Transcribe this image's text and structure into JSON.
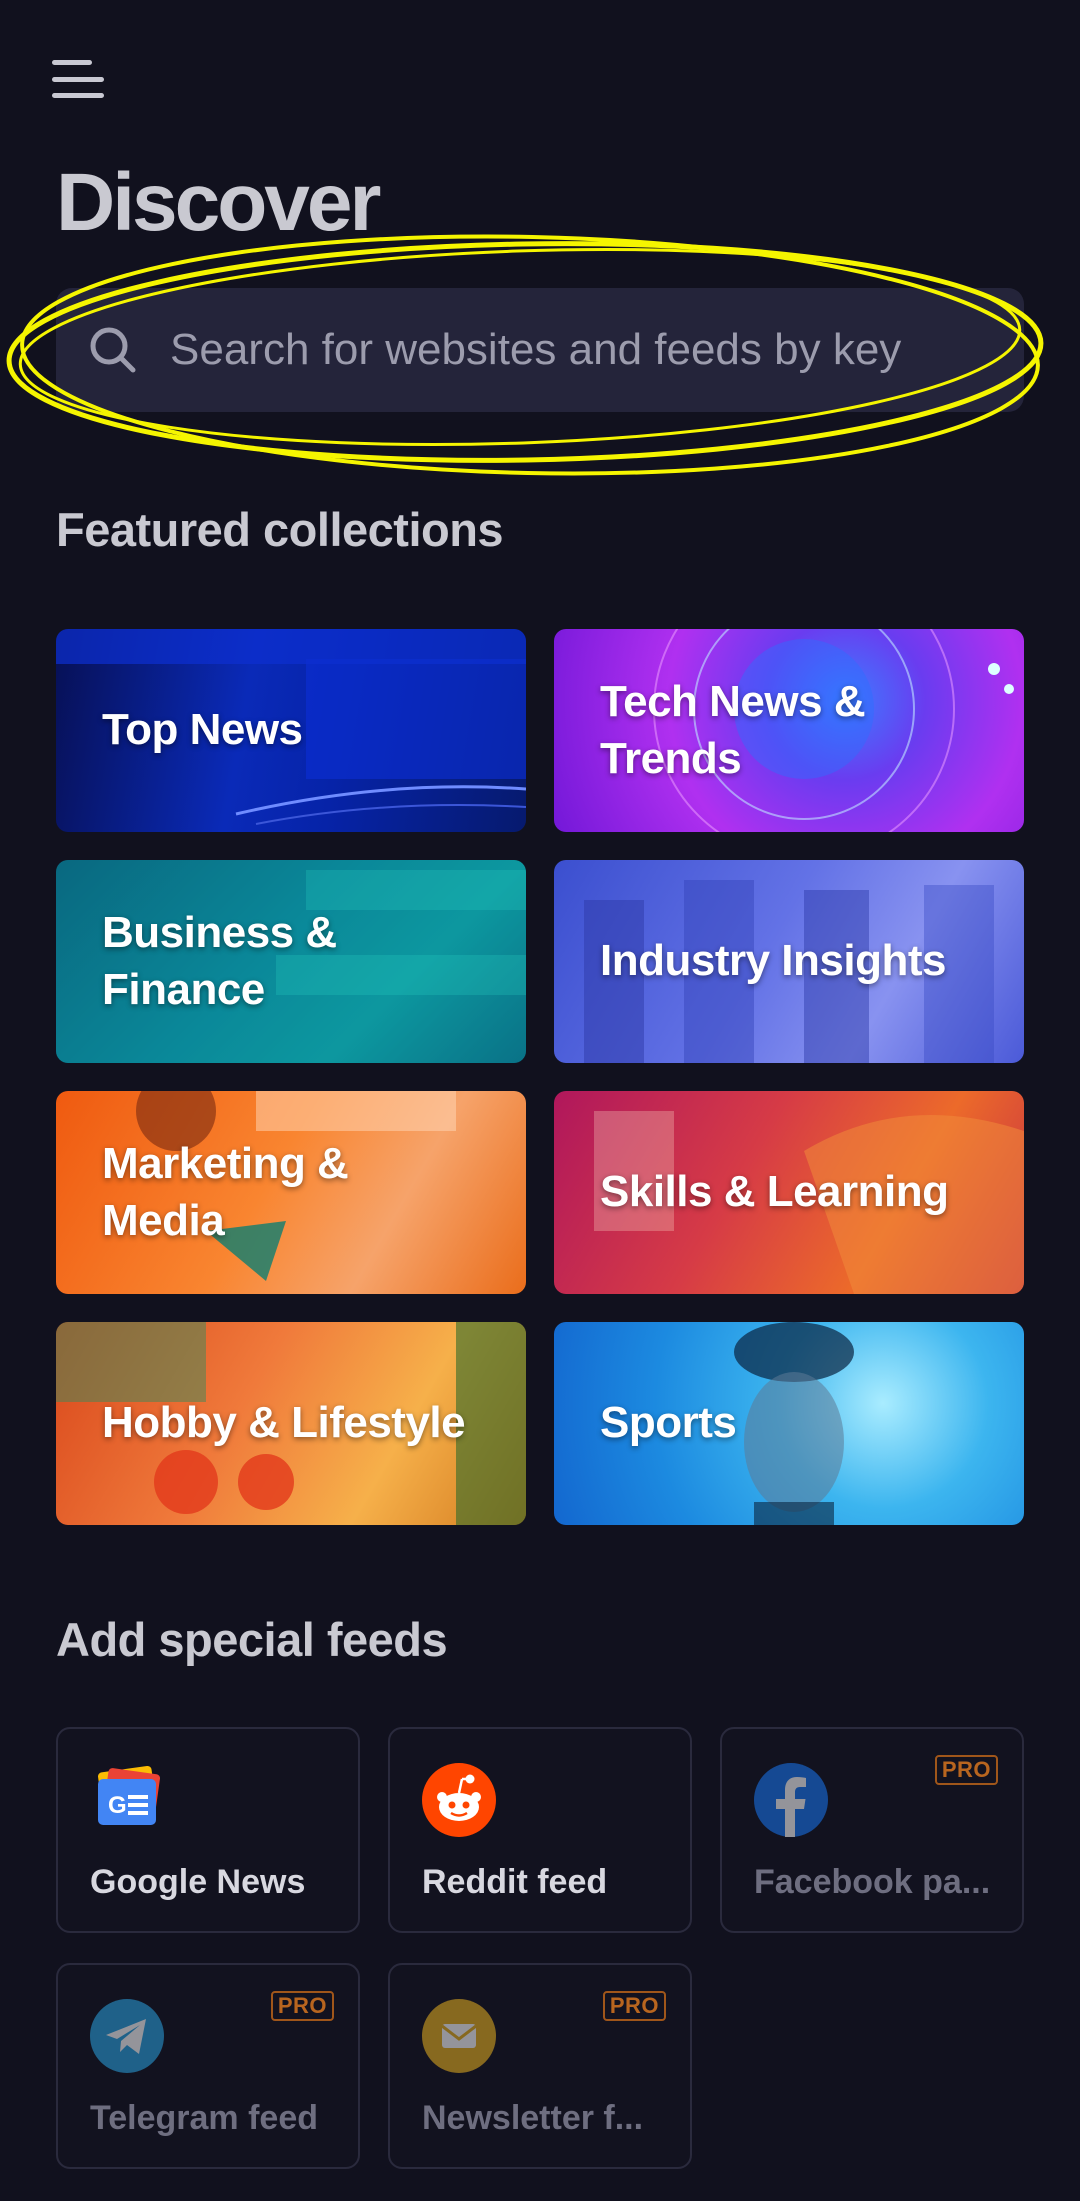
{
  "header": {
    "title": "Discover"
  },
  "search": {
    "placeholder": "Search for websites and feeds by key"
  },
  "featured": {
    "title": "Featured collections",
    "items": [
      {
        "label": "Top News",
        "label2": ""
      },
      {
        "label": "Tech News &",
        "label2": "Trends"
      },
      {
        "label": "Business &",
        "label2": "Finance"
      },
      {
        "label": "Industry Insights",
        "label2": ""
      },
      {
        "label": "Marketing & Media",
        "label2": ""
      },
      {
        "label": "Skills & Learning",
        "label2": ""
      },
      {
        "label": "Hobby & Lifestyle",
        "label2": ""
      },
      {
        "label": "Sports",
        "label2": ""
      }
    ]
  },
  "special": {
    "title": "Add special feeds",
    "pro_label": "PRO",
    "items": [
      {
        "label": "Google News",
        "icon": "google-news-icon",
        "pro": false
      },
      {
        "label": "Reddit feed",
        "icon": "reddit-icon",
        "pro": false
      },
      {
        "label": "Facebook pa...",
        "icon": "facebook-icon",
        "pro": true
      },
      {
        "label": "Telegram feed",
        "icon": "telegram-icon",
        "pro": true
      },
      {
        "label": "Newsletter f...",
        "icon": "mail-icon",
        "pro": true
      }
    ]
  },
  "colors": {
    "background": "#11111e",
    "search_bg": "#24243a",
    "annotation": "#f5f500",
    "pro": "#b8651f"
  }
}
